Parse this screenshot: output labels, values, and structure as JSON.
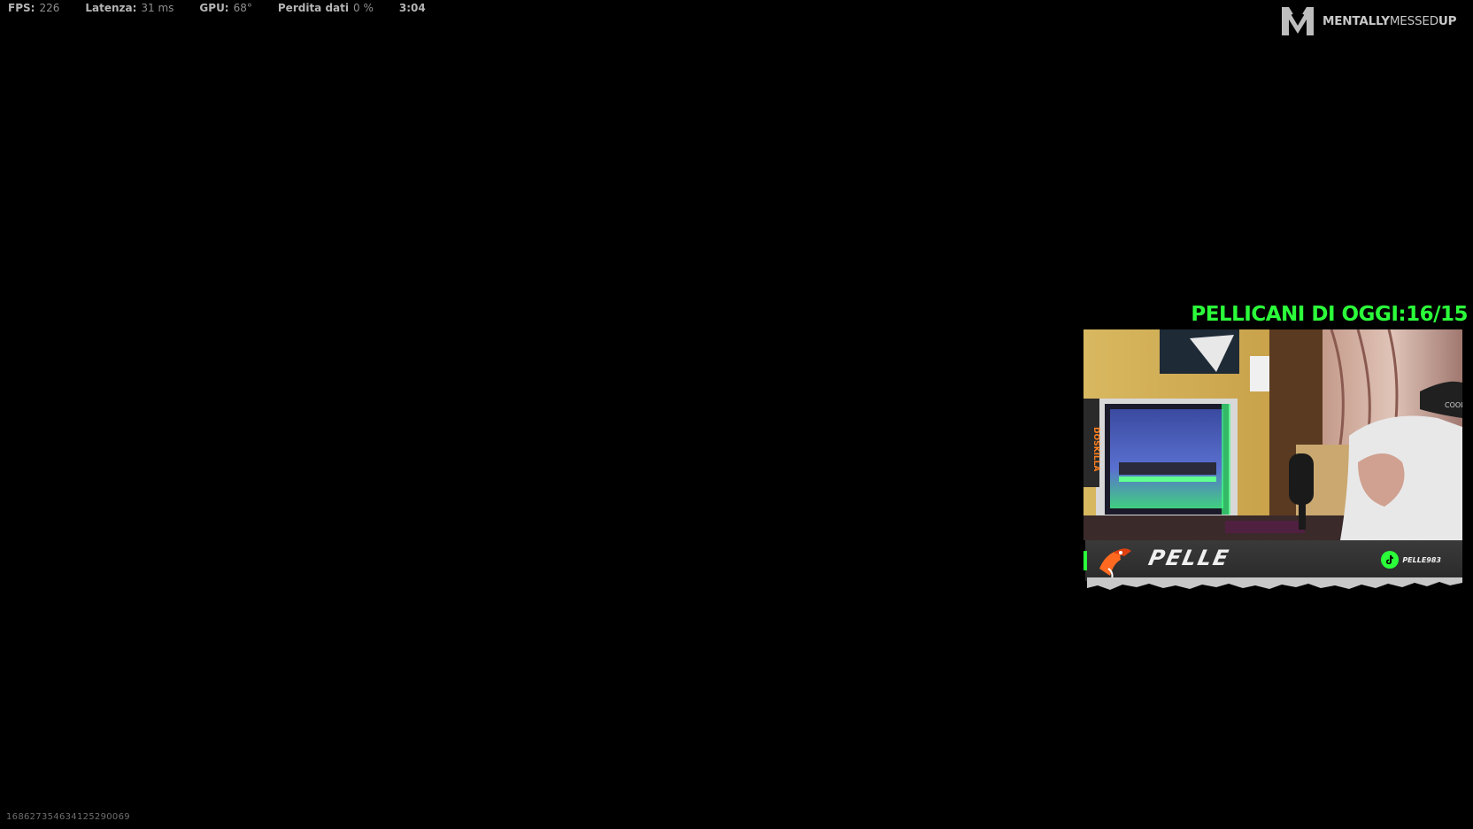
{
  "hud": {
    "fps_label": "FPS:",
    "fps_value": "226",
    "latency_label": "Latenza:",
    "latency_value": "31 ms",
    "gpu_label": "GPU:",
    "gpu_value": "68°",
    "loss_label": "Perdita dati",
    "loss_value": "0 %",
    "time": "3:04"
  },
  "brand": {
    "part1": "MENTALLY",
    "part2": "MESSED",
    "part3": "UP",
    "icon": "m-chevron-logo-icon"
  },
  "counter": {
    "text": "PELLICANI DI OGGI:16/15",
    "color": "#2bff3a"
  },
  "webcam": {
    "case_brand": "DOSKILLA",
    "streamer_name": "PELLE",
    "tiktok_handle": "PELLE983",
    "icons": [
      "bird-logo-icon",
      "tiktok-icon"
    ]
  },
  "session_id": "16862735463412529006​9"
}
